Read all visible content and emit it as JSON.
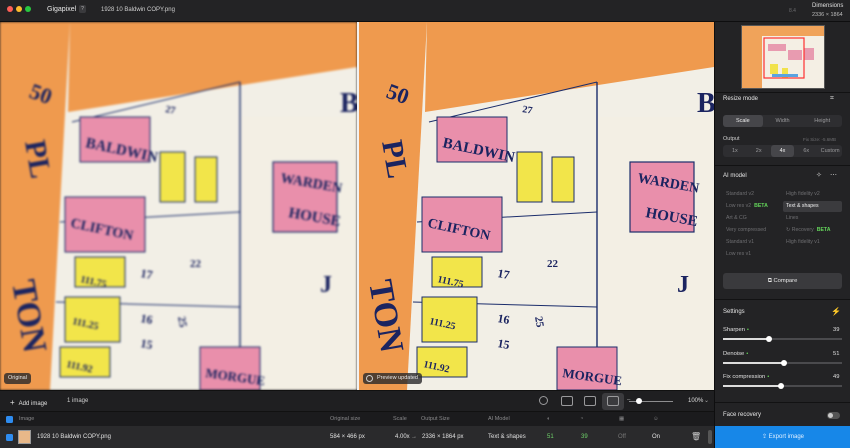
{
  "titlebar": {
    "app_name": "Gigapixel",
    "help": "?",
    "filename": "1928 10 Baldwin COPY.png",
    "version": "8.4",
    "dimensions_label": "Dimensions",
    "dimensions_value": "2336 × 1864",
    "dot_colors": [
      "#ff5f57",
      "#febc2e",
      "#28c840"
    ]
  },
  "viewer": {
    "original_label": "Original",
    "preview_label": "Preview updated",
    "map_text": {
      "baldwin": "BALDWIN",
      "clifton": "CLIFTON",
      "warden": "WARDEN",
      "house": "HOUSE",
      "morgue": "MORGUE",
      "pl": "PL",
      "ton": "TON",
      "lot_50": "50",
      "letter_b": "B",
      "letter_j": "J",
      "n_15": "15",
      "n_16": "16",
      "n_17": "17",
      "n_22": "22",
      "n_25": "25",
      "n_27": "27",
      "n_111_75": "111.75",
      "n_111_25": "111.25",
      "n_111_92": "111.92"
    }
  },
  "toolbar": {
    "add_image": "Add image",
    "image_count": "1 image",
    "zoom": "100%"
  },
  "table": {
    "headers": {
      "image": "Image",
      "original_size": "Original size",
      "scale": "Scale",
      "output_size": "Output Size",
      "ai_model": "AI Model"
    },
    "row": {
      "name": "1928 10 Baldwin COPY.png",
      "original_size": "584 × 466 px",
      "scale": "4.00x",
      "output_size": "2336 × 1864 px",
      "model": "Text & shapes",
      "sharpen": "51",
      "denoise": "39",
      "fix": "Off",
      "face": "On"
    }
  },
  "sidebar": {
    "resize_title": "Resize mode",
    "resize_tabs": [
      "Scale",
      "Width",
      "Height"
    ],
    "output_label": "Output",
    "fix_size": "Fix Size: -5.6MB",
    "scale_options": [
      "1x",
      "2x",
      "4x",
      "6x",
      "Custom"
    ],
    "ai_title": "AI model",
    "models": {
      "standard_v2": "Standard v2",
      "high_fidelity_v2": "High fidelity v2",
      "low_res_v2": "Low res v2",
      "text_shapes": "Text & shapes",
      "art_cg": "Art & CG",
      "lines": "Lines",
      "very_compressed": "Very compressed",
      "recovery": "Recovery",
      "standard_v1": "Standard v1",
      "high_fidelity_v1": "High fidelity v1",
      "low_res_v1": "Low res v1",
      "beta": "BETA"
    },
    "compare": "Compare",
    "settings_title": "Settings",
    "sliders": [
      {
        "label": "Sharpen",
        "value": "39",
        "fraction": 0.39
      },
      {
        "label": "Denoise",
        "value": "51",
        "fraction": 0.51
      },
      {
        "label": "Fix compression",
        "value": "49",
        "fraction": 0.49
      }
    ],
    "face_recovery": "Face recovery",
    "export": "Export image"
  }
}
